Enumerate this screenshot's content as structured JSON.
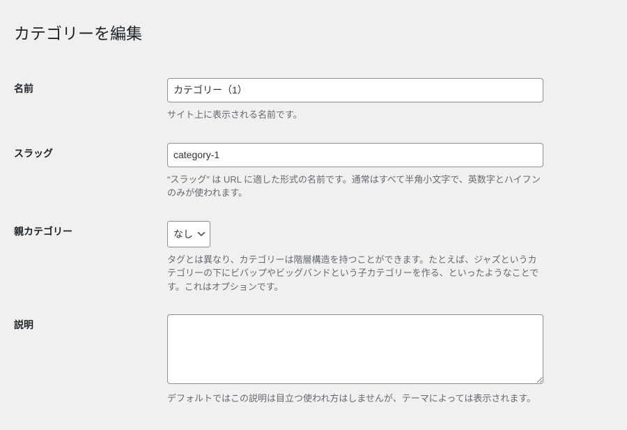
{
  "page": {
    "title": "カテゴリーを編集"
  },
  "fields": {
    "name": {
      "label": "名前",
      "value": "カテゴリー（1）",
      "description": "サイト上に表示される名前です。"
    },
    "slug": {
      "label": "スラッグ",
      "value": "category-1",
      "description": "“スラッグ” は URL に適した形式の名前です。通常はすべて半角小文字で、英数字とハイフンのみが使われます。"
    },
    "parent": {
      "label": "親カテゴリー",
      "selected": "なし",
      "description": "タグとは異なり、カテゴリーは階層構造を持つことができます。たとえば、ジャズというカテゴリーの下にビバップやビッグバンドという子カテゴリーを作る、といったようなことです。これはオプションです。"
    },
    "description": {
      "label": "説明",
      "value": "",
      "description": "デフォルトではこの説明は目立つ使われ方はしませんが、テーマによっては表示されます。"
    }
  }
}
